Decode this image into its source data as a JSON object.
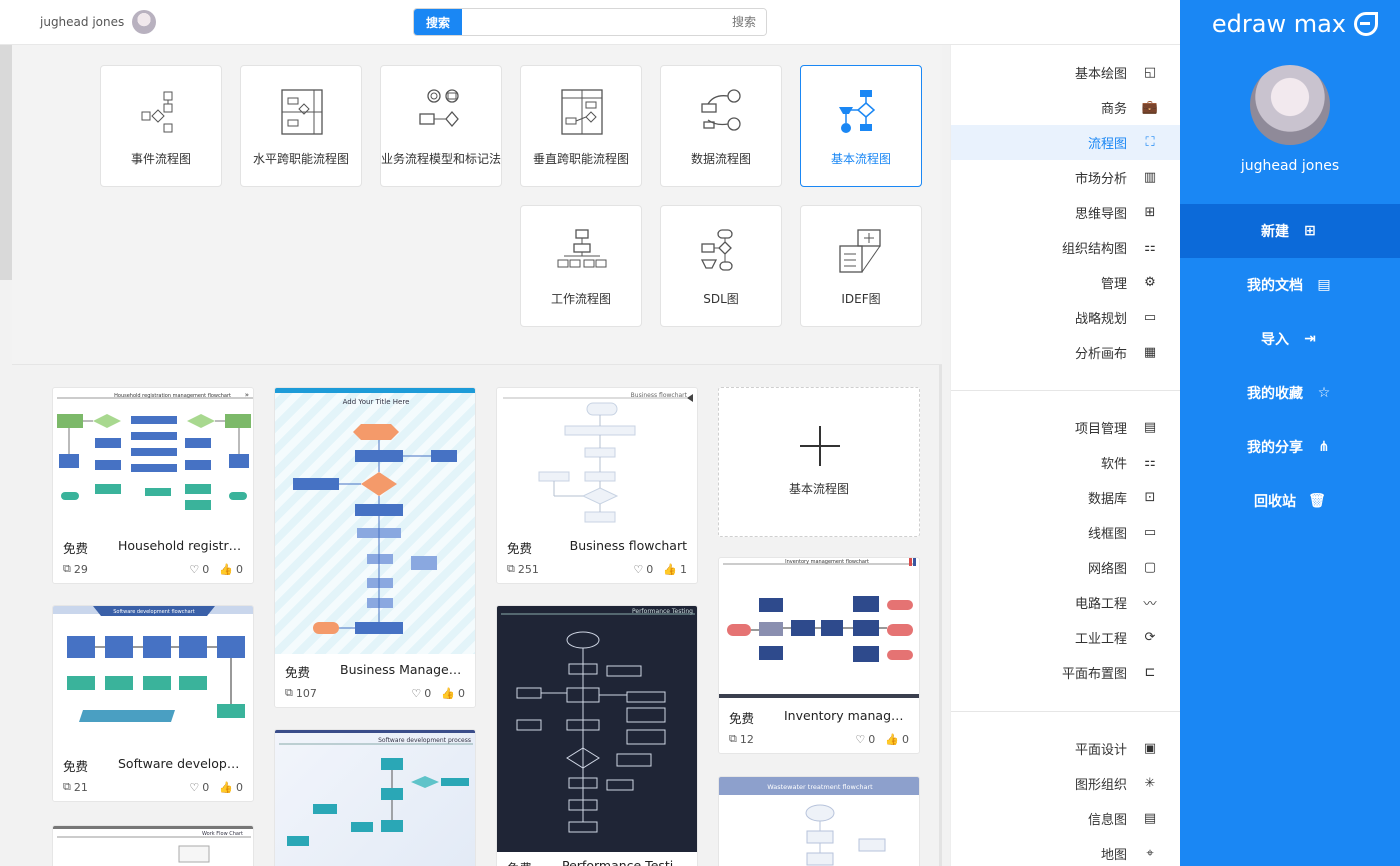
{
  "app": {
    "name": "edraw max"
  },
  "user": {
    "name": "jughead jones"
  },
  "search": {
    "button_label": "搜索",
    "placeholder": "搜索"
  },
  "nav": [
    {
      "label": "新建",
      "icon": "plus-square-icon",
      "active": true
    },
    {
      "label": "我的文档",
      "icon": "document-icon"
    },
    {
      "label": "导入",
      "icon": "import-icon"
    },
    {
      "label": "我的收藏",
      "icon": "star-icon"
    },
    {
      "label": "我的分享",
      "icon": "share-icon"
    },
    {
      "label": "回收站",
      "icon": "trash-icon"
    }
  ],
  "categories": [
    {
      "label": "基本绘图",
      "icon": "shapes-icon"
    },
    {
      "label": "商务",
      "icon": "briefcase-icon"
    },
    {
      "label": "流程图",
      "icon": "flowchart-icon",
      "active": true
    },
    {
      "label": "市场分析",
      "icon": "bar-chart-icon"
    },
    {
      "label": "思维导图",
      "icon": "mindmap-icon"
    },
    {
      "label": "组织结构图",
      "icon": "org-chart-icon"
    },
    {
      "label": "管理",
      "icon": "gear-icon"
    },
    {
      "label": "战略规划",
      "icon": "strategy-icon"
    },
    {
      "label": "分析画布",
      "icon": "canvas-icon"
    },
    {
      "label": "项目管理",
      "icon": "project-icon"
    },
    {
      "label": "软件",
      "icon": "software-icon"
    },
    {
      "label": "数据库",
      "icon": "database-icon"
    },
    {
      "label": "线框图",
      "icon": "wireframe-icon"
    },
    {
      "label": "网络图",
      "icon": "network-icon"
    },
    {
      "label": "电路工程",
      "icon": "circuit-icon"
    },
    {
      "label": "工业工程",
      "icon": "industry-icon"
    },
    {
      "label": "平面布置图",
      "icon": "floorplan-icon"
    },
    {
      "label": "平面设计",
      "icon": "design-icon"
    },
    {
      "label": "图形组织",
      "icon": "graphic-organizer-icon"
    },
    {
      "label": "信息图",
      "icon": "infographic-icon"
    },
    {
      "label": "地图",
      "icon": "map-pin-icon"
    }
  ],
  "diagram_types": [
    {
      "label": "基本流程图",
      "active": true
    },
    {
      "label": "数据流程图"
    },
    {
      "label": "垂直跨职能流程图"
    },
    {
      "label": "业务流程模型和标记法"
    },
    {
      "label": "水平跨职能流程图"
    },
    {
      "label": "事件流程图"
    },
    {
      "label": "IDEF图"
    },
    {
      "label": "SDL图"
    },
    {
      "label": "工作流程图"
    }
  ],
  "new_blank": {
    "label": "基本流程图"
  },
  "templates": [
    {
      "name": "Business flowchart",
      "tag": "免费",
      "likes": "1",
      "favs": "0",
      "copies": "251",
      "thumb_title": "Business flowchart"
    },
    {
      "name": "Business Manageme...",
      "tag": "免费",
      "likes": "0",
      "favs": "0",
      "copies": "107",
      "thumb_title": "Add Your Title Here"
    },
    {
      "name": "Household registratio...",
      "tag": "免费",
      "likes": "0",
      "favs": "0",
      "copies": "29",
      "thumb_title": "Household registration management flowchart"
    },
    {
      "name": "Inventory manageme...",
      "tag": "免费",
      "likes": "0",
      "favs": "0",
      "copies": "12",
      "thumb_title": "Inventory management flowchart"
    },
    {
      "name": "Performance Testing",
      "tag": "免费",
      "likes": "",
      "favs": "",
      "copies": "",
      "thumb_title": "Performance Testing"
    },
    {
      "name": "Software developmen...",
      "tag": "免费",
      "likes": "0",
      "favs": "0",
      "copies": "21",
      "thumb_title": "Software development flowchart"
    },
    {
      "name": "",
      "tag": "",
      "thumb_title": "Software development process"
    },
    {
      "name": "",
      "tag": "",
      "thumb_title": "Wastewater treatment flowchart"
    },
    {
      "name": "",
      "tag": "",
      "thumb_title": "Work Flow Chart"
    }
  ]
}
